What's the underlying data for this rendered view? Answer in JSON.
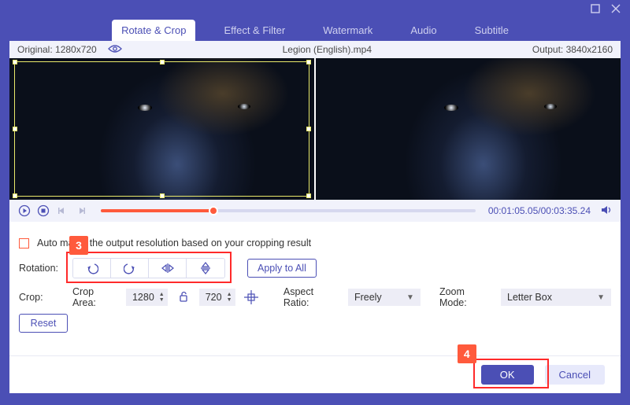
{
  "window": {
    "tabs": [
      "Rotate & Crop",
      "Effect & Filter",
      "Watermark",
      "Audio",
      "Subtitle"
    ],
    "active_tab_index": 0
  },
  "infobar": {
    "original_label": "Original: 1280x720",
    "filename": "Legion (English).mp4",
    "output_label": "Output: 3840x2160"
  },
  "transport": {
    "current_time": "00:01:05.05",
    "total_time": "00:03:35.24",
    "progress_pct": 30
  },
  "auto_match": {
    "label": "Auto match the output resolution based on your cropping result",
    "checked": false
  },
  "rotation": {
    "label": "Rotation:",
    "buttons": [
      "rotate-left",
      "rotate-right",
      "flip-horizontal",
      "flip-vertical"
    ],
    "apply_all": "Apply to All"
  },
  "crop": {
    "label": "Crop:",
    "area_label": "Crop Area:",
    "width": "1280",
    "height": "720",
    "aspect_label": "Aspect Ratio:",
    "aspect_value": "Freely",
    "zoom_label": "Zoom Mode:",
    "zoom_value": "Letter Box",
    "reset": "Reset"
  },
  "callouts": {
    "c3": "3",
    "c4": "4"
  },
  "footer": {
    "ok": "OK",
    "cancel": "Cancel"
  }
}
